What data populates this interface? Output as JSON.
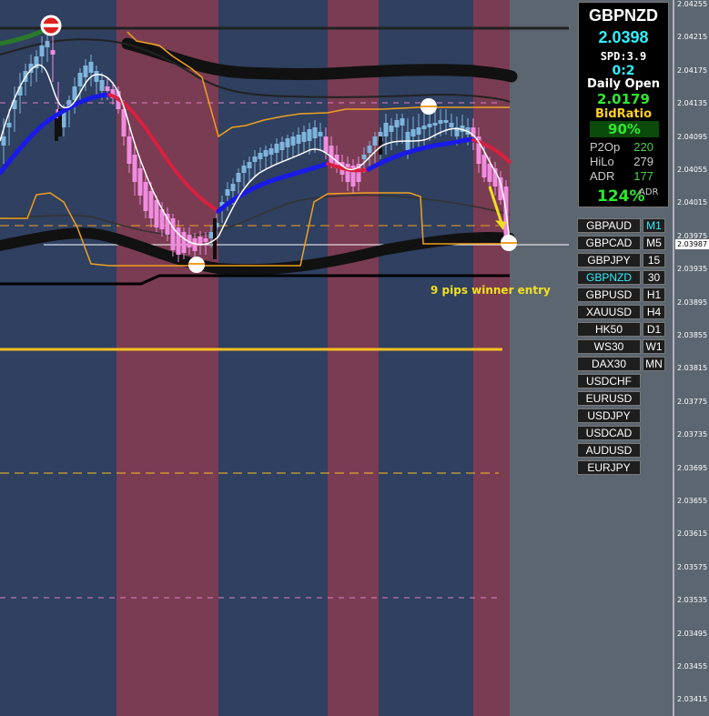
{
  "info_panel": {
    "symbol": "GBPNZD",
    "price": "2.0398",
    "spread": "SPD:3.9",
    "ratio": "0:2",
    "daily_open_label": "Daily Open",
    "daily_open_value": "2.0179",
    "bid_ratio_label": "BidRatio",
    "bid_ratio_value": "90%",
    "p2op_label": "P2Op",
    "p2op_value": "220",
    "hilo_label": "HiLo",
    "hilo_value": "279",
    "adr_label": "ADR",
    "adr_value": "177",
    "adr_pct": "124%",
    "adr_suffix": "ADR"
  },
  "symbol_buttons": [
    "GBPAUD",
    "GBPCAD",
    "GBPJPY",
    "GBPNZD",
    "GBPUSD",
    "XAUUSD",
    "HK50",
    "WS30",
    "DAX30",
    "USDCHF",
    "EURUSD",
    "USDJPY",
    "USDCAD",
    "AUDUSD",
    "EURJPY"
  ],
  "active_symbol": "GBPNZD",
  "timeframe_buttons": [
    "M1",
    "M5",
    "15",
    "30",
    "H1",
    "H4",
    "D1",
    "W1",
    "MN"
  ],
  "active_timeframe": "M1",
  "price_axis": [
    "2.04255",
    "2.04215",
    "2.04175",
    "2.04135",
    "2.04095",
    "2.04055",
    "2.04015",
    "2.03975",
    "2.03935",
    "2.03895",
    "2.03855",
    "2.03815",
    "2.03775",
    "2.03735",
    "2.03695",
    "2.03655",
    "2.03615",
    "2.03575",
    "2.03535",
    "2.03495",
    "2.03455",
    "2.03415"
  ],
  "current_price_label": "2.03987",
  "annotation": "9 pips winner entry",
  "colors": {
    "session_blue": "#2f4060",
    "session_red": "#7a3c52",
    "bull_candle": "#7fb4dc",
    "bear_candle": "#f08ce0",
    "ma_up": "#1a1ae8",
    "ma_down": "#d82040",
    "envelope": "#f0a020",
    "gold_line": "#f8c020"
  }
}
